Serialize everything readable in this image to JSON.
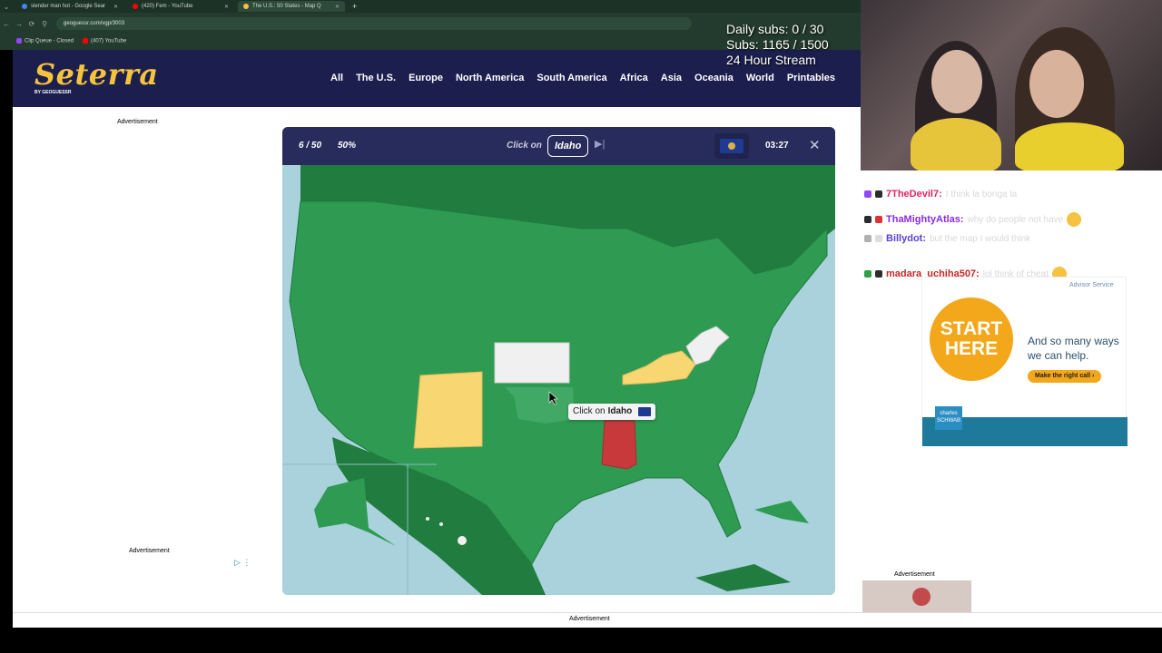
{
  "browser": {
    "tabs": [
      {
        "label": "slender man hot - Google Sear",
        "color": "#4285f4"
      },
      {
        "label": "(420) Fem - YouTube",
        "color": "#ff0000"
      },
      {
        "label": "The U.S.: 50 States - Map Q",
        "color": "#f7c33c"
      }
    ],
    "url": "geoguessr.com/vgp/3003",
    "bookmarks": [
      {
        "label": "Clip Queue - Closed",
        "color": "#9146ff"
      },
      {
        "label": "(407) YouTube",
        "color": "#ff0000"
      }
    ]
  },
  "site": {
    "logo": "Seterra",
    "logo_sub": "BY GEOGUESSR",
    "nav": [
      "All",
      "The U.S.",
      "Europe",
      "North America",
      "South America",
      "Africa",
      "Asia",
      "Oceania",
      "World",
      "Printables"
    ],
    "ad_label_left": "Advertisement",
    "ad_label_left2": "Advertisement",
    "ad_label_bottom": "Advertisement"
  },
  "game": {
    "score": "6 / 50",
    "percent": "50%",
    "click_on": "Click on",
    "target": "Idaho",
    "timer": "03:27",
    "tooltip_prefix": "Click on",
    "tooltip_target": "Idaho",
    "colors": {
      "land": "#2e9a52",
      "land_dark": "#217d3f",
      "water": "#a9d2dc",
      "correct_white": "#f0f0f0",
      "yellow": "#f8d773",
      "red": "#c8393c"
    }
  },
  "stream": {
    "overlay_lines": [
      "Daily subs: 0 / 30",
      "Subs: 1165 / 1500",
      "24 Hour Stream"
    ],
    "chat": [
      {
        "user": "7TheDevil7:",
        "color": "#e0245e",
        "text": "I think la bonga la"
      },
      {
        "user": "ThaMightyAtlas:",
        "color": "#8a2be2",
        "text": "why do people not have"
      },
      {
        "user": "Billydot:",
        "color": "#5b3fd6",
        "text": "but the map I would think"
      },
      {
        "user": "madara_uchiha507:",
        "color": "#c62828",
        "text": "lol think of cheat"
      }
    ],
    "ad": {
      "service": "Advisor Service",
      "circle": "START HERE",
      "text": "And so many ways we can help.",
      "cta": "Make the right call ›",
      "brand": "charles SCHWAB",
      "label": "Advertisement"
    },
    "ad_label_small": "Advertisement"
  }
}
